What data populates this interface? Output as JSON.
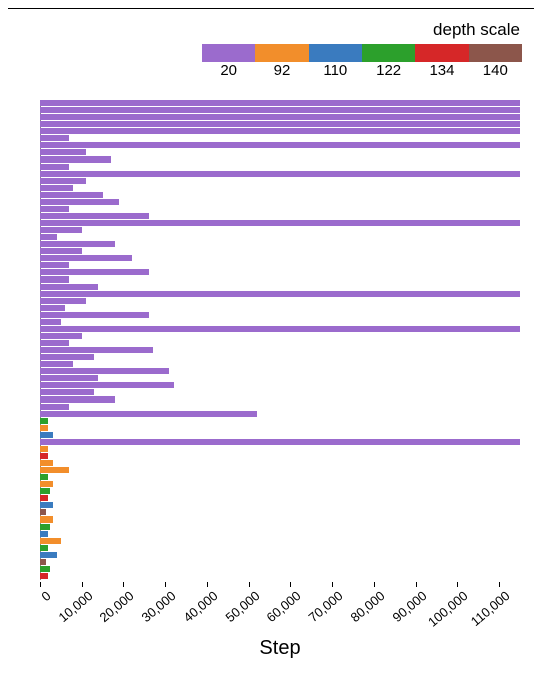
{
  "legend": {
    "title": "depth scale",
    "segments": [
      {
        "label": "20",
        "color": "#9b6bcd"
      },
      {
        "label": "92",
        "color": "#f28e2b"
      },
      {
        "label": "110",
        "color": "#3a7bbf"
      },
      {
        "label": "122",
        "color": "#2ca02c"
      },
      {
        "label": "134",
        "color": "#d62728"
      },
      {
        "label": "140",
        "color": "#8c564b"
      }
    ]
  },
  "chart_data": {
    "type": "bar",
    "orientation": "horizontal",
    "xlabel": "Step",
    "ylabel": "",
    "xlim": [
      0,
      115000
    ],
    "x_ticks": [
      0,
      10000,
      20000,
      30000,
      40000,
      50000,
      60000,
      70000,
      80000,
      90000,
      100000,
      110000
    ],
    "bars": [
      {
        "value": 115000,
        "depth_scale": 20
      },
      {
        "value": 115000,
        "depth_scale": 20
      },
      {
        "value": 115000,
        "depth_scale": 20
      },
      {
        "value": 115000,
        "depth_scale": 20
      },
      {
        "value": 115000,
        "depth_scale": 20
      },
      {
        "value": 7000,
        "depth_scale": 20
      },
      {
        "value": 115000,
        "depth_scale": 20
      },
      {
        "value": 11000,
        "depth_scale": 20
      },
      {
        "value": 17000,
        "depth_scale": 20
      },
      {
        "value": 7000,
        "depth_scale": 20
      },
      {
        "value": 115000,
        "depth_scale": 20
      },
      {
        "value": 11000,
        "depth_scale": 20
      },
      {
        "value": 8000,
        "depth_scale": 20
      },
      {
        "value": 15000,
        "depth_scale": 20
      },
      {
        "value": 19000,
        "depth_scale": 20
      },
      {
        "value": 7000,
        "depth_scale": 20
      },
      {
        "value": 26000,
        "depth_scale": 20
      },
      {
        "value": 115000,
        "depth_scale": 20
      },
      {
        "value": 10000,
        "depth_scale": 20
      },
      {
        "value": 4000,
        "depth_scale": 20
      },
      {
        "value": 18000,
        "depth_scale": 20
      },
      {
        "value": 10000,
        "depth_scale": 20
      },
      {
        "value": 22000,
        "depth_scale": 20
      },
      {
        "value": 7000,
        "depth_scale": 20
      },
      {
        "value": 26000,
        "depth_scale": 20
      },
      {
        "value": 7000,
        "depth_scale": 20
      },
      {
        "value": 14000,
        "depth_scale": 20
      },
      {
        "value": 115000,
        "depth_scale": 20
      },
      {
        "value": 11000,
        "depth_scale": 20
      },
      {
        "value": 6000,
        "depth_scale": 20
      },
      {
        "value": 26000,
        "depth_scale": 20
      },
      {
        "value": 5000,
        "depth_scale": 20
      },
      {
        "value": 115000,
        "depth_scale": 20
      },
      {
        "value": 10000,
        "depth_scale": 20
      },
      {
        "value": 7000,
        "depth_scale": 20
      },
      {
        "value": 27000,
        "depth_scale": 20
      },
      {
        "value": 13000,
        "depth_scale": 20
      },
      {
        "value": 8000,
        "depth_scale": 20
      },
      {
        "value": 31000,
        "depth_scale": 20
      },
      {
        "value": 14000,
        "depth_scale": 20
      },
      {
        "value": 32000,
        "depth_scale": 20
      },
      {
        "value": 13000,
        "depth_scale": 20
      },
      {
        "value": 18000,
        "depth_scale": 20
      },
      {
        "value": 7000,
        "depth_scale": 20
      },
      {
        "value": 52000,
        "depth_scale": 20
      },
      {
        "value": 2000,
        "depth_scale": 122
      },
      {
        "value": 2000,
        "depth_scale": 92
      },
      {
        "value": 3000,
        "depth_scale": 110
      },
      {
        "value": 115000,
        "depth_scale": 20
      },
      {
        "value": 2000,
        "depth_scale": 92
      },
      {
        "value": 2000,
        "depth_scale": 134
      },
      {
        "value": 3000,
        "depth_scale": 92
      },
      {
        "value": 7000,
        "depth_scale": 92
      },
      {
        "value": 2000,
        "depth_scale": 122
      },
      {
        "value": 3000,
        "depth_scale": 92
      },
      {
        "value": 2500,
        "depth_scale": 122
      },
      {
        "value": 2000,
        "depth_scale": 134
      },
      {
        "value": 3000,
        "depth_scale": 110
      },
      {
        "value": 1500,
        "depth_scale": 140
      },
      {
        "value": 3000,
        "depth_scale": 92
      },
      {
        "value": 2500,
        "depth_scale": 122
      },
      {
        "value": 2000,
        "depth_scale": 110
      },
      {
        "value": 5000,
        "depth_scale": 92
      },
      {
        "value": 2000,
        "depth_scale": 122
      },
      {
        "value": 4000,
        "depth_scale": 110
      },
      {
        "value": 1500,
        "depth_scale": 140
      },
      {
        "value": 2500,
        "depth_scale": 122
      },
      {
        "value": 2000,
        "depth_scale": 134
      }
    ]
  },
  "colors": {
    "20": "#9b6bcd",
    "92": "#f28e2b",
    "110": "#3a7bbf",
    "122": "#2ca02c",
    "134": "#d62728",
    "140": "#8c564b"
  }
}
